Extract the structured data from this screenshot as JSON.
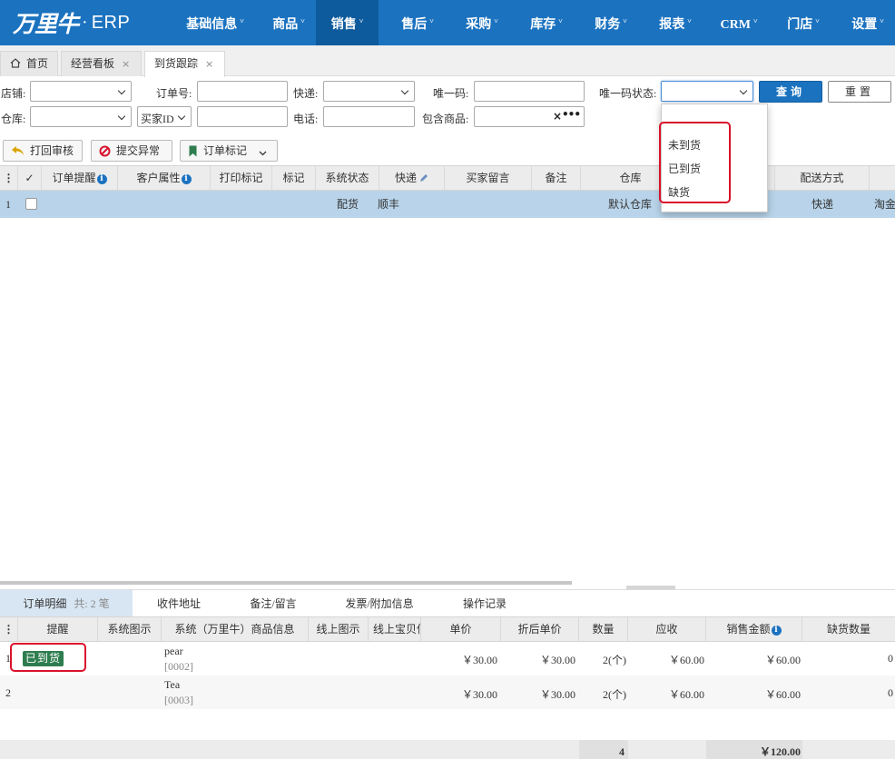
{
  "app": {
    "logo_text": "万里牛",
    "logo_dot": "·",
    "logo_suffix": "ERP"
  },
  "nav": [
    {
      "label": "基础信息"
    },
    {
      "label": "商品"
    },
    {
      "label": "销售",
      "active": true
    },
    {
      "label": "售后"
    },
    {
      "label": "采购"
    },
    {
      "label": "库存"
    },
    {
      "label": "财务"
    },
    {
      "label": "报表"
    },
    {
      "label": "CRM"
    },
    {
      "label": "门店"
    },
    {
      "label": "设置"
    }
  ],
  "nav_caret": "˅",
  "tabs": {
    "home": "首页",
    "dashboard": "经营看板",
    "arrival": "到货跟踪",
    "close": "×"
  },
  "filters": {
    "shop_label": "店铺:",
    "order_no_label": "订单号:",
    "express_label": "快递:",
    "unique_code_label": "唯一码:",
    "unique_status_label": "唯一码状态:",
    "warehouse_label": "仓库:",
    "buyer_id_select": "买家ID",
    "phone_label": "电话:",
    "contains_goods_label": "包含商品:",
    "clear": "×",
    "more": "•••"
  },
  "buttons": {
    "query": "查询",
    "reset": "重置",
    "return_review": "打回审核",
    "submit_exception": "提交异常",
    "order_mark": "订单标记"
  },
  "status_dropdown": {
    "options": [
      "未到货",
      "已到货",
      "缺货"
    ]
  },
  "grid": {
    "menu": "⋮",
    "check": "✓",
    "columns": {
      "reminder": "订单提醒",
      "customer_attr": "客户属性",
      "print_mark": "打印标记",
      "mark": "标记",
      "system_status": "系统状态",
      "express": "快递",
      "buyer_msg": "买家留言",
      "remark": "备注",
      "warehouse": "仓库",
      "delivery": "配送方式"
    },
    "rows": [
      {
        "index": "1",
        "status": "配货",
        "express": "顺丰",
        "warehouse": "默认仓库",
        "delivery": "快递",
        "extra": "淘金"
      }
    ]
  },
  "detail": {
    "tabs": {
      "order_detail": "订单明细",
      "count": "共: 2 笔",
      "address": "收件地址",
      "remark": "备注/留言",
      "invoice": "发票/附加信息",
      "log": "操作记录"
    },
    "columns": {
      "reminder": "提醒",
      "sys_image": "系统图示",
      "sys_goods": "系统（万里牛）商品信息",
      "online_image": "线上图示",
      "online_item": "线上宝贝信息",
      "unit_price": "单价",
      "discount_price": "折后单价",
      "qty": "数量",
      "receivable": "应收",
      "sales_amount": "销售金额",
      "short_qty": "缺货数量"
    },
    "rows": [
      {
        "index": "1",
        "badge": "已到货",
        "name": "pear",
        "sku": "[0002]",
        "price": "￥30.00",
        "discount": "￥30.00",
        "qty": "2(个)",
        "receivable": "￥60.00",
        "amount": "￥60.00",
        "short": "0"
      },
      {
        "index": "2",
        "badge": "",
        "name": "Tea",
        "sku": "[0003]",
        "price": "￥30.00",
        "discount": "￥30.00",
        "qty": "2(个)",
        "receivable": "￥60.00",
        "amount": "￥60.00",
        "short": "0"
      }
    ],
    "totals": {
      "qty": "4",
      "amount": "￥120.00"
    }
  },
  "colors": {
    "nav_bg": "#1b72bf",
    "nav_active": "#0d5a9c",
    "row_selected": "#b9d4ea",
    "badge_green": "#2e7d4f",
    "highlight_red": "#d9112a"
  }
}
